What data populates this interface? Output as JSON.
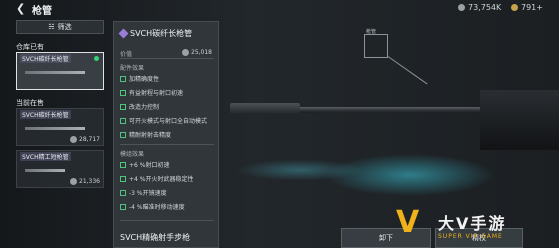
{
  "header": {
    "back_icon": "back-arrow-icon",
    "title": "枪管",
    "currency1": "73,754K",
    "currency2": "791+"
  },
  "left": {
    "filter_label": "筛选",
    "owned_label": "仓库已有",
    "owned_item": "SVCH碳纤长枪管",
    "equipped_label": "当前在售",
    "sale_items": [
      {
        "name": "SVCH碳纤长枪管",
        "price": "28,717"
      },
      {
        "name": "SVCH精工短枪管",
        "price": "21,336"
      }
    ]
  },
  "detail": {
    "title": "SVCH碳纤长枪管",
    "value_label": "价值",
    "value": "25,018",
    "attr_heading": "配件效果",
    "attrs": [
      "加精确度性",
      "有益射程与射口初速",
      "改造力控制",
      "可开火模式与射口全自动模式",
      "精耐射射击精度"
    ],
    "adv_heading": "模组效果",
    "advs": [
      "+6 %射口初速",
      "+4 %开火时武器稳定性",
      "-3 %开镜速度",
      "-4 %瞄准时移动速度"
    ],
    "bottom_name": "SVCH精确射手步枪"
  },
  "scene": {
    "scope_label": "枪管"
  },
  "buttons": {
    "unequip": "卸下",
    "calibrate": "精校"
  },
  "watermark": {
    "logo": "V",
    "cn": "大V手游",
    "en": "SUPER VIP GAME"
  }
}
